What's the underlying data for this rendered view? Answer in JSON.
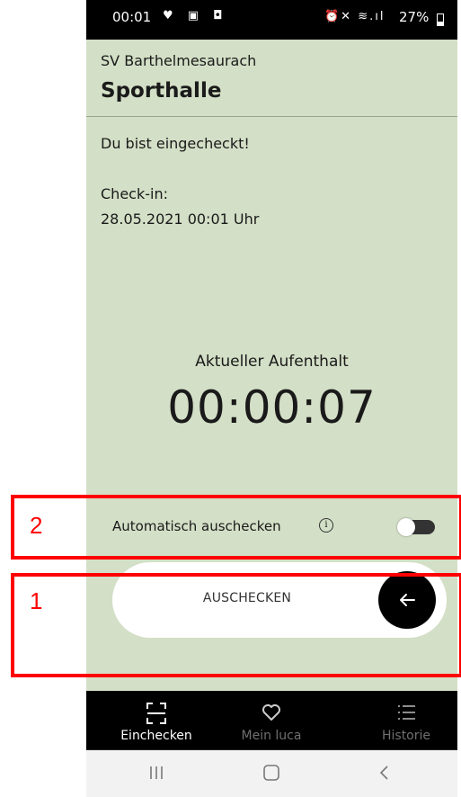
{
  "status_bar": {
    "time": "00:01",
    "left_icons": "♥ ▣ ◘",
    "right_icons": "⏰✕ ≋.ıl",
    "battery": "27%"
  },
  "venue": {
    "organization": "SV Barthelmesaurach",
    "name": "Sporthalle"
  },
  "checkin": {
    "status": "Du bist eingecheckt!",
    "label": "Check-in:",
    "time": "28.05.2021 00:01 Uhr"
  },
  "stay": {
    "label": "Aktueller Aufenthalt",
    "timer": "00:00:07"
  },
  "auto_checkout": {
    "label": "Automatisch auschecken",
    "info_icon": "i",
    "enabled": false
  },
  "checkout_button": {
    "label": "AUSCHECKEN",
    "arrow_icon": "arrow-left-icon"
  },
  "bottom_nav": {
    "items": [
      {
        "label": "Einchecken",
        "icon": "qr-scan-icon",
        "active": true
      },
      {
        "label": "Mein luca",
        "icon": "heart-icon",
        "active": false
      },
      {
        "label": "Historie",
        "icon": "list-icon",
        "active": false
      }
    ]
  },
  "annotations": {
    "box_1": "1",
    "box_2": "2",
    "color": "#ff0000"
  },
  "colors": {
    "background": "#d3dfc6",
    "button_dark": "#000000",
    "highlight": "#ff0000"
  }
}
